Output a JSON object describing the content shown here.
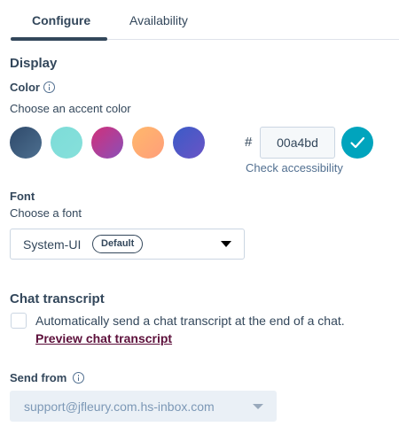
{
  "tabs": [
    {
      "label": "Configure",
      "active": true
    },
    {
      "label": "Availability",
      "active": false
    }
  ],
  "display": {
    "heading": "Display",
    "color_label": "Color",
    "color_hint": "Choose an accent color",
    "swatches": [
      {
        "name": "navy",
        "from": "#2f4a6b",
        "to": "#4d6f8f"
      },
      {
        "name": "aqua",
        "from": "#7ddcd8",
        "to": "#86e0db"
      },
      {
        "name": "magenta",
        "from": "#d1307a",
        "to": "#8a4fb8"
      },
      {
        "name": "peach",
        "from": "#ffb86b",
        "to": "#ff9e7a"
      },
      {
        "name": "indigo",
        "from": "#3a5bc7",
        "to": "#6a54c6"
      }
    ],
    "hash": "#",
    "hex_value": "00a4bd",
    "accent": "#00a4bd",
    "check_accessibility": "Check accessibility"
  },
  "font": {
    "label": "Font",
    "hint": "Choose a font",
    "selected": "System-UI",
    "badge": "Default"
  },
  "chat_transcript": {
    "heading": "Chat transcript",
    "checkbox_label": "Automatically send a chat transcript at the end of a chat.",
    "checked": false,
    "preview_link": "Preview chat transcript"
  },
  "send_from": {
    "label": "Send from",
    "value": "support@jfleury.com.hs-inbox.com"
  }
}
